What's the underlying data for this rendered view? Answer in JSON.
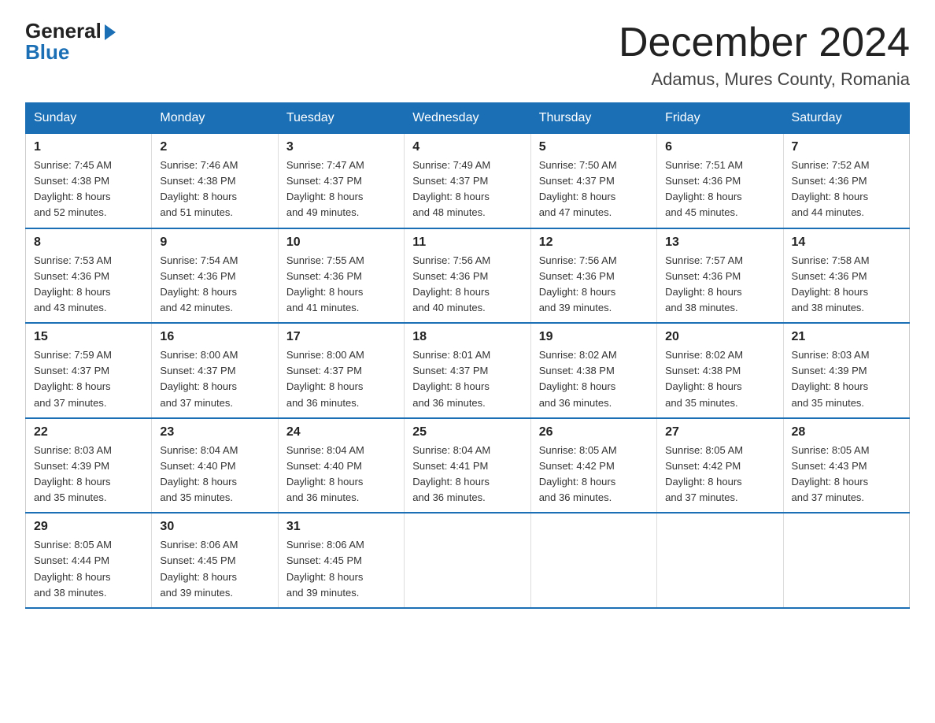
{
  "logo": {
    "general": "General",
    "blue": "Blue"
  },
  "title": "December 2024",
  "subtitle": "Adamus, Mures County, Romania",
  "weekdays": [
    "Sunday",
    "Monday",
    "Tuesday",
    "Wednesday",
    "Thursday",
    "Friday",
    "Saturday"
  ],
  "weeks": [
    [
      {
        "day": "1",
        "sunrise": "7:45 AM",
        "sunset": "4:38 PM",
        "daylight": "8 hours and 52 minutes."
      },
      {
        "day": "2",
        "sunrise": "7:46 AM",
        "sunset": "4:38 PM",
        "daylight": "8 hours and 51 minutes."
      },
      {
        "day": "3",
        "sunrise": "7:47 AM",
        "sunset": "4:37 PM",
        "daylight": "8 hours and 49 minutes."
      },
      {
        "day": "4",
        "sunrise": "7:49 AM",
        "sunset": "4:37 PM",
        "daylight": "8 hours and 48 minutes."
      },
      {
        "day": "5",
        "sunrise": "7:50 AM",
        "sunset": "4:37 PM",
        "daylight": "8 hours and 47 minutes."
      },
      {
        "day": "6",
        "sunrise": "7:51 AM",
        "sunset": "4:36 PM",
        "daylight": "8 hours and 45 minutes."
      },
      {
        "day": "7",
        "sunrise": "7:52 AM",
        "sunset": "4:36 PM",
        "daylight": "8 hours and 44 minutes."
      }
    ],
    [
      {
        "day": "8",
        "sunrise": "7:53 AM",
        "sunset": "4:36 PM",
        "daylight": "8 hours and 43 minutes."
      },
      {
        "day": "9",
        "sunrise": "7:54 AM",
        "sunset": "4:36 PM",
        "daylight": "8 hours and 42 minutes."
      },
      {
        "day": "10",
        "sunrise": "7:55 AM",
        "sunset": "4:36 PM",
        "daylight": "8 hours and 41 minutes."
      },
      {
        "day": "11",
        "sunrise": "7:56 AM",
        "sunset": "4:36 PM",
        "daylight": "8 hours and 40 minutes."
      },
      {
        "day": "12",
        "sunrise": "7:56 AM",
        "sunset": "4:36 PM",
        "daylight": "8 hours and 39 minutes."
      },
      {
        "day": "13",
        "sunrise": "7:57 AM",
        "sunset": "4:36 PM",
        "daylight": "8 hours and 38 minutes."
      },
      {
        "day": "14",
        "sunrise": "7:58 AM",
        "sunset": "4:36 PM",
        "daylight": "8 hours and 38 minutes."
      }
    ],
    [
      {
        "day": "15",
        "sunrise": "7:59 AM",
        "sunset": "4:37 PM",
        "daylight": "8 hours and 37 minutes."
      },
      {
        "day": "16",
        "sunrise": "8:00 AM",
        "sunset": "4:37 PM",
        "daylight": "8 hours and 37 minutes."
      },
      {
        "day": "17",
        "sunrise": "8:00 AM",
        "sunset": "4:37 PM",
        "daylight": "8 hours and 36 minutes."
      },
      {
        "day": "18",
        "sunrise": "8:01 AM",
        "sunset": "4:37 PM",
        "daylight": "8 hours and 36 minutes."
      },
      {
        "day": "19",
        "sunrise": "8:02 AM",
        "sunset": "4:38 PM",
        "daylight": "8 hours and 36 minutes."
      },
      {
        "day": "20",
        "sunrise": "8:02 AM",
        "sunset": "4:38 PM",
        "daylight": "8 hours and 35 minutes."
      },
      {
        "day": "21",
        "sunrise": "8:03 AM",
        "sunset": "4:39 PM",
        "daylight": "8 hours and 35 minutes."
      }
    ],
    [
      {
        "day": "22",
        "sunrise": "8:03 AM",
        "sunset": "4:39 PM",
        "daylight": "8 hours and 35 minutes."
      },
      {
        "day": "23",
        "sunrise": "8:04 AM",
        "sunset": "4:40 PM",
        "daylight": "8 hours and 35 minutes."
      },
      {
        "day": "24",
        "sunrise": "8:04 AM",
        "sunset": "4:40 PM",
        "daylight": "8 hours and 36 minutes."
      },
      {
        "day": "25",
        "sunrise": "8:04 AM",
        "sunset": "4:41 PM",
        "daylight": "8 hours and 36 minutes."
      },
      {
        "day": "26",
        "sunrise": "8:05 AM",
        "sunset": "4:42 PM",
        "daylight": "8 hours and 36 minutes."
      },
      {
        "day": "27",
        "sunrise": "8:05 AM",
        "sunset": "4:42 PM",
        "daylight": "8 hours and 37 minutes."
      },
      {
        "day": "28",
        "sunrise": "8:05 AM",
        "sunset": "4:43 PM",
        "daylight": "8 hours and 37 minutes."
      }
    ],
    [
      {
        "day": "29",
        "sunrise": "8:05 AM",
        "sunset": "4:44 PM",
        "daylight": "8 hours and 38 minutes."
      },
      {
        "day": "30",
        "sunrise": "8:06 AM",
        "sunset": "4:45 PM",
        "daylight": "8 hours and 39 minutes."
      },
      {
        "day": "31",
        "sunrise": "8:06 AM",
        "sunset": "4:45 PM",
        "daylight": "8 hours and 39 minutes."
      },
      null,
      null,
      null,
      null
    ]
  ],
  "labels": {
    "sunrise": "Sunrise:",
    "sunset": "Sunset:",
    "daylight": "Daylight:"
  }
}
